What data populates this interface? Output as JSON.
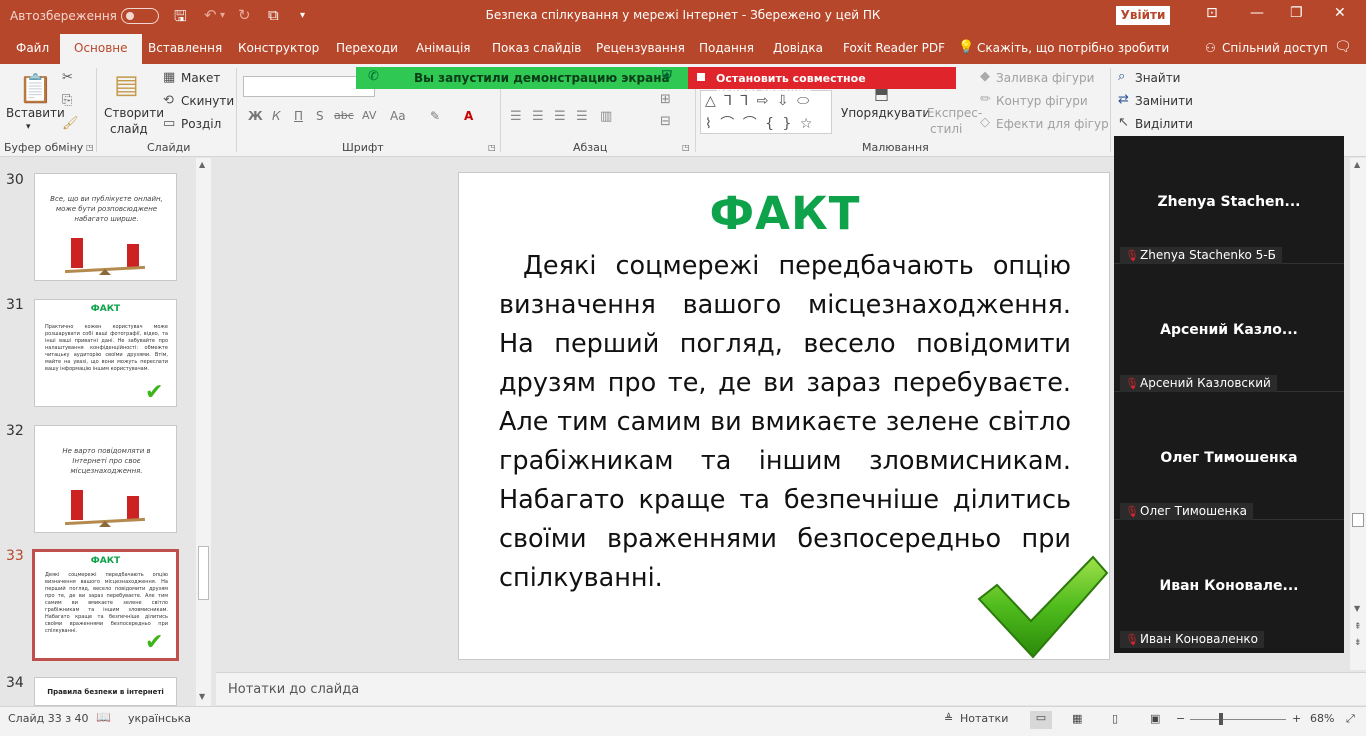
{
  "titlebar": {
    "autosave_label": "Автозбереження",
    "document_title": "Безпека спілкування у мережі Інтернет  -  Збережено у цей ПК",
    "signin_label": "Увійти"
  },
  "tabs": [
    {
      "label": "Файл"
    },
    {
      "label": "Основне"
    },
    {
      "label": "Вставлення"
    },
    {
      "label": "Конструктор"
    },
    {
      "label": "Переходи"
    },
    {
      "label": "Анімація"
    },
    {
      "label": "Показ слайдів"
    },
    {
      "label": "Рецензування"
    },
    {
      "label": "Подання"
    },
    {
      "label": "Довідка"
    },
    {
      "label": "Foxit Reader PDF"
    },
    {
      "label": "Скажіть, що потрібно зробити"
    },
    {
      "label": "Спільний доступ"
    }
  ],
  "ribbon": {
    "paste": "Вставити",
    "clipboard_group": "Буфер обміну",
    "new_slide": "Створити",
    "new_slide2": "слайд",
    "layout": "Макет",
    "reset": "Скинути",
    "section": "Розділ",
    "slides_group": "Слайди",
    "font_group": "Шрифт",
    "paragraph_group": "Абзац",
    "arrange": "Упорядкувати",
    "quick_styles": "Експрес-",
    "quick_styles2": "стилі",
    "shape_fill": "Заливка фігури",
    "shape_outline": "Контур фігури",
    "shape_effects": "Ефекти для фігур",
    "drawing_group": "Малювання",
    "find": "Знайти",
    "replace": "Замінити",
    "select": "Виділити",
    "bold": "Ж",
    "italic": "К",
    "underline": "П",
    "strike": "abc",
    "spacing": "AV",
    "case": "Aa"
  },
  "share_banner": {
    "started": "Вы запустили демонстрацию экрана",
    "stop": "Остановить совместное использование"
  },
  "thumbnails": [
    {
      "num": "30",
      "text": "Все, що ви публікуєте онлайн, може бути розповсюджене набагато ширше."
    },
    {
      "num": "31",
      "title": "ФАКТ",
      "text": "Практично кожен користувач може розшарувати собі ваші фотографії, відео, та інші ваші приватні дані. Не забувайте про налаштування конфіденційності: обмежте читацьку аудиторію своїми друзями. Втім, майте на увазі, що вони можуть переслати вашу інформацію іншим користувачам."
    },
    {
      "num": "32",
      "text": "Не варто повідомляти в Інтернеті про своє місцезнаходження."
    },
    {
      "num": "33",
      "title": "ФАКТ",
      "text": "Деякі соцмережі передбачають опцію визначення вашого місцезнаходження. На перший погляд, весело повідомити друзям про те, де ви зараз перебуваєте. Але тим самим ви вмикаєте зелене світло грабіжникам та іншим зловмисникам. Набагато краще та безпечніше ділитись своїми враженнями безпосередньо при спілкуванні."
    },
    {
      "num": "34",
      "title": "Правила безпеки в інтернеті"
    }
  ],
  "slide": {
    "title": "ФАКТ",
    "body": "Деякі соцмережі передбачають опцію визначення вашого місцезнаходження. На перший погляд, весело повідомити друзям про те, де ви зараз перебуваєте. Але тим самим ви вмикаєте зелене світло грабіжникам та іншим зловмисникам. Набагато краще та безпечніше ділитись своїми враженнями безпосередньо при спілкуванні."
  },
  "notes_placeholder": "Нотатки до слайда",
  "participants": [
    {
      "display": "Zhenya  Stachen...",
      "name": "Zhenya Stachenko 5-Б"
    },
    {
      "display": "Арсений  Казло...",
      "name": "Арсений Казловский"
    },
    {
      "display": "Олег Тимошенка",
      "name": "Олег Тимошенка"
    },
    {
      "display": "Иван  Коновале...",
      "name": "Иван Коноваленко"
    }
  ],
  "statusbar": {
    "slide_counter": "Слайд 33 з 40",
    "language": "українська",
    "notes": "Нотатки",
    "zoom": "68%"
  },
  "colors": {
    "accent": "#b7472a",
    "title_green": "#0ea24a",
    "share_green": "#2ec852",
    "share_red": "#e0242b"
  }
}
